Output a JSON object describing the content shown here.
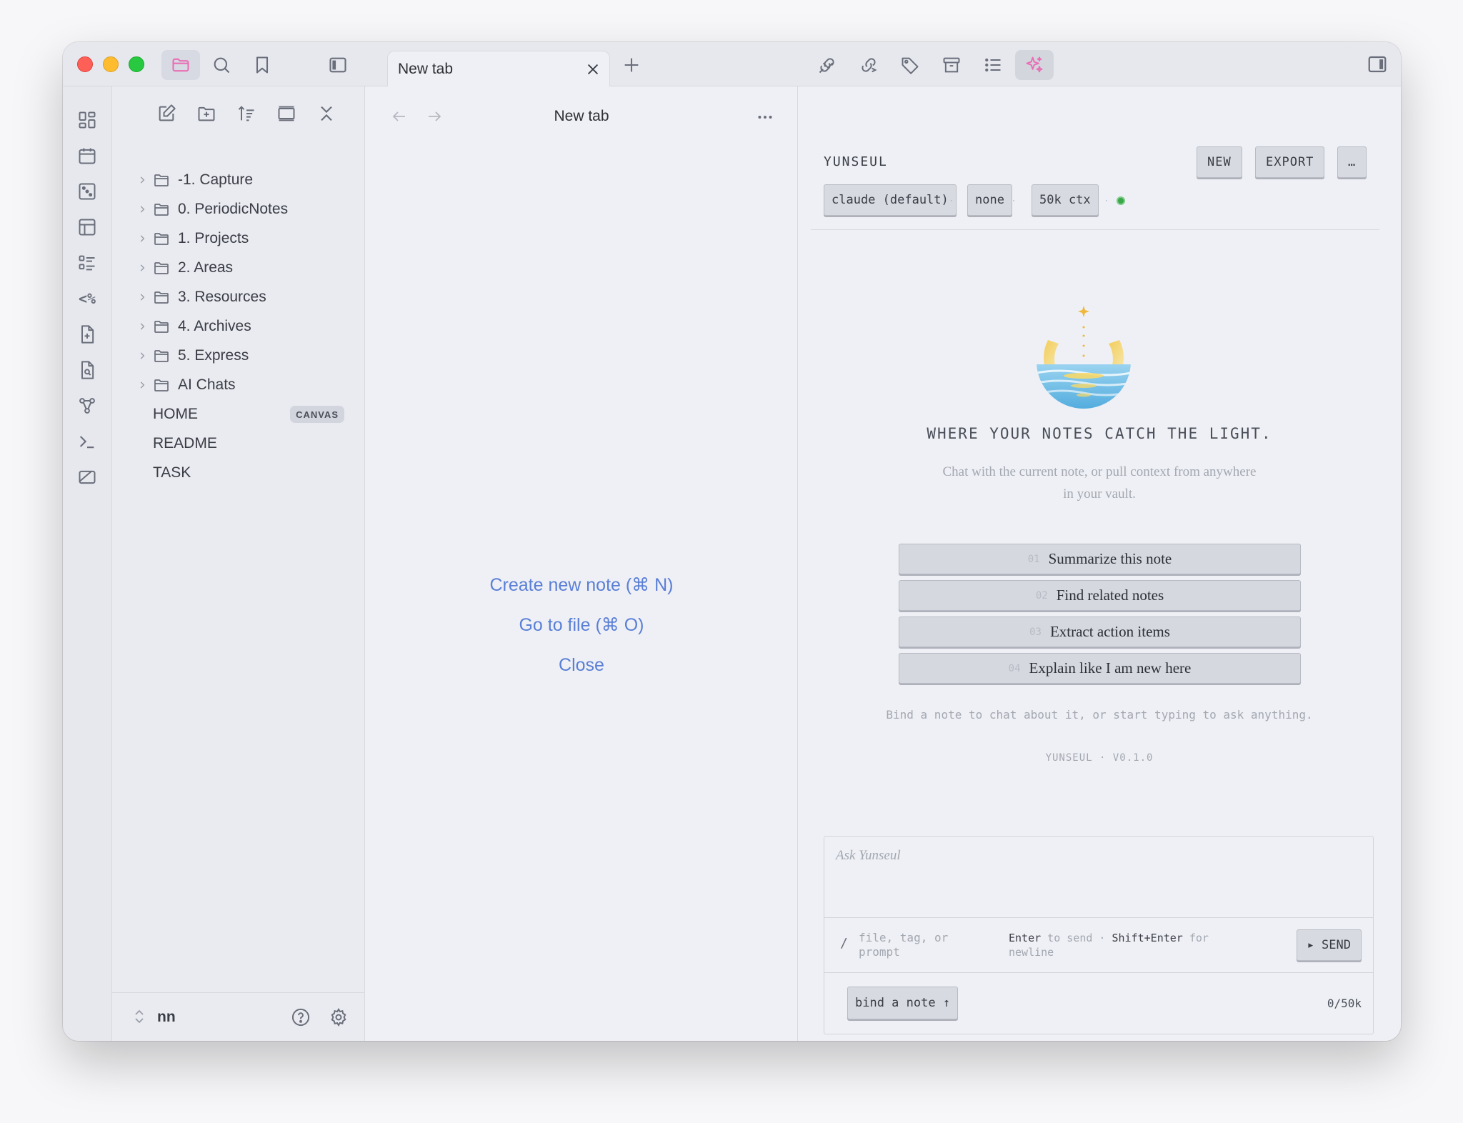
{
  "window": {
    "title": "New tab"
  },
  "titlebar": {
    "left_icons": [
      "folder-icon",
      "search-icon",
      "bookmark-icon",
      "sidebar-toggle-icon"
    ],
    "right_icons": [
      "backlinks-icon",
      "outgoing-links-icon",
      "tag-icon",
      "archive-icon",
      "outline-icon",
      "ai-sparkle-icon"
    ]
  },
  "tabs": [
    {
      "label": "New tab",
      "active": true
    }
  ],
  "ribbon": {
    "items": [
      "dashboard-icon",
      "calendar-icon",
      "random-note-icon",
      "layout-icon",
      "checklist-icon",
      "template-icon",
      "new-file-icon",
      "search-file-icon",
      "graph-icon",
      "terminal-icon",
      "slides-icon"
    ],
    "template_text": "<%"
  },
  "sidebar": {
    "toolbar": [
      "new-note-icon",
      "new-folder-icon",
      "sort-icon",
      "auto-reveal-icon",
      "collapse-all-icon"
    ],
    "folders": [
      {
        "label": "-1. Capture"
      },
      {
        "label": "0. PeriodicNotes"
      },
      {
        "label": "1. Projects"
      },
      {
        "label": "2. Areas"
      },
      {
        "label": "3. Resources"
      },
      {
        "label": "4. Archives"
      },
      {
        "label": "5. Express"
      },
      {
        "label": "AI Chats"
      }
    ],
    "files": [
      {
        "label": "HOME",
        "badge": "CANVAS"
      },
      {
        "label": "README",
        "badge": ""
      },
      {
        "label": "TASK",
        "badge": ""
      }
    ],
    "vault_name": "nn"
  },
  "main": {
    "view_title": "New tab",
    "actions": {
      "create": "Create new note (⌘ N)",
      "goto": "Go to file (⌘ O)",
      "close": "Close"
    }
  },
  "assistant": {
    "brand": "YUNSEUL",
    "buttons": {
      "new": "NEW",
      "export": "EXPORT",
      "more": "…"
    },
    "chips": {
      "model": "claude (default)",
      "mode": "none",
      "context": "50k ctx",
      "separator": "·"
    },
    "status": "connected",
    "tagline": "WHERE YOUR NOTES CATCH THE LIGHT.",
    "description": "Chat with the current note, or pull context from anywhere in your vault.",
    "prompts": [
      {
        "num": "01",
        "label": "Summarize this note"
      },
      {
        "num": "02",
        "label": "Find related notes"
      },
      {
        "num": "03",
        "label": "Extract action items"
      },
      {
        "num": "04",
        "label": "Explain like I am new here"
      }
    ],
    "hint": "Bind a note to chat about it, or start typing to ask anything.",
    "version": "YUNSEUL · V0.1.0",
    "composer": {
      "placeholder": "Ask Yunseul",
      "slash": "/",
      "slash_hint": "file, tag, or prompt",
      "enter_key": "Enter",
      "enter_text": " to send · ",
      "shift_key": "Shift+Enter",
      "shift_text": " for newline",
      "send": "▸ SEND",
      "bind": "bind a note ↑",
      "token_count": "0/50k"
    }
  },
  "colors": {
    "accent_link": "#5a7fd6",
    "folder_active": "#e86fb5",
    "ai_active": "#e86fb5",
    "status_dot": "#3ca64a"
  }
}
